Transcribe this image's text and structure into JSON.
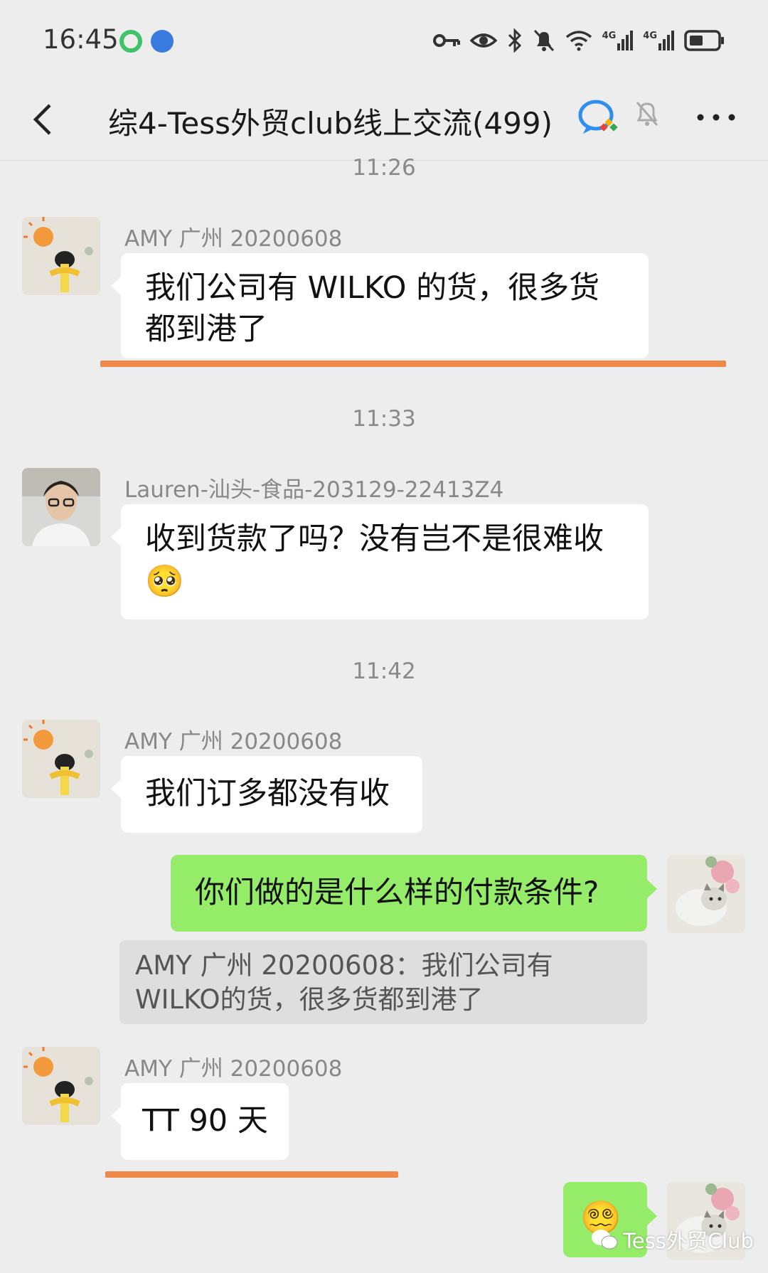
{
  "status_bar": {
    "time": "16:45",
    "icons": [
      "app-green-icon",
      "app-blue-icon",
      "key-icon",
      "eye-icon",
      "bluetooth-icon",
      "mute-bell-icon",
      "wifi-icon",
      "signal-4g-icon",
      "signal-4g-icon",
      "battery-icon"
    ],
    "net1": "4G",
    "net2": "4G"
  },
  "header": {
    "title": "综4-Tess外贸club线上交流(499)"
  },
  "timestamps": [
    "11:26",
    "11:33",
    "11:42"
  ],
  "messages": [
    {
      "sender": "AMY 广州  20200608",
      "text": "我们公司有 WILKO 的货，很多货都到港了",
      "line1": "我们公司有 WILKO 的货，很多货",
      "line2": "都到港了"
    },
    {
      "sender": "Lauren-汕头-食品-203129-22413Z4",
      "text": "收到货款了吗？没有岂不是很难收",
      "emoji": "🥺"
    },
    {
      "sender": "AMY 广州  20200608",
      "text": "我们订多都没有收"
    },
    {
      "sender": "me",
      "text": "你们做的是什么样的付款条件?",
      "quote_line1": "AMY 广州  20200608：我们公司有",
      "quote_line2": "WILKO的货，很多货都到港了"
    },
    {
      "sender": "AMY 广州  20200608",
      "text": "TT 90 天"
    },
    {
      "sender": "me",
      "emoji": "😵‍💫"
    }
  ],
  "watermark": "Tess外贸Club",
  "colors": {
    "background": "#ededed",
    "bubble_incoming": "#ffffff",
    "bubble_outgoing": "#95ec69",
    "highlight_underline": "#f0884a"
  }
}
